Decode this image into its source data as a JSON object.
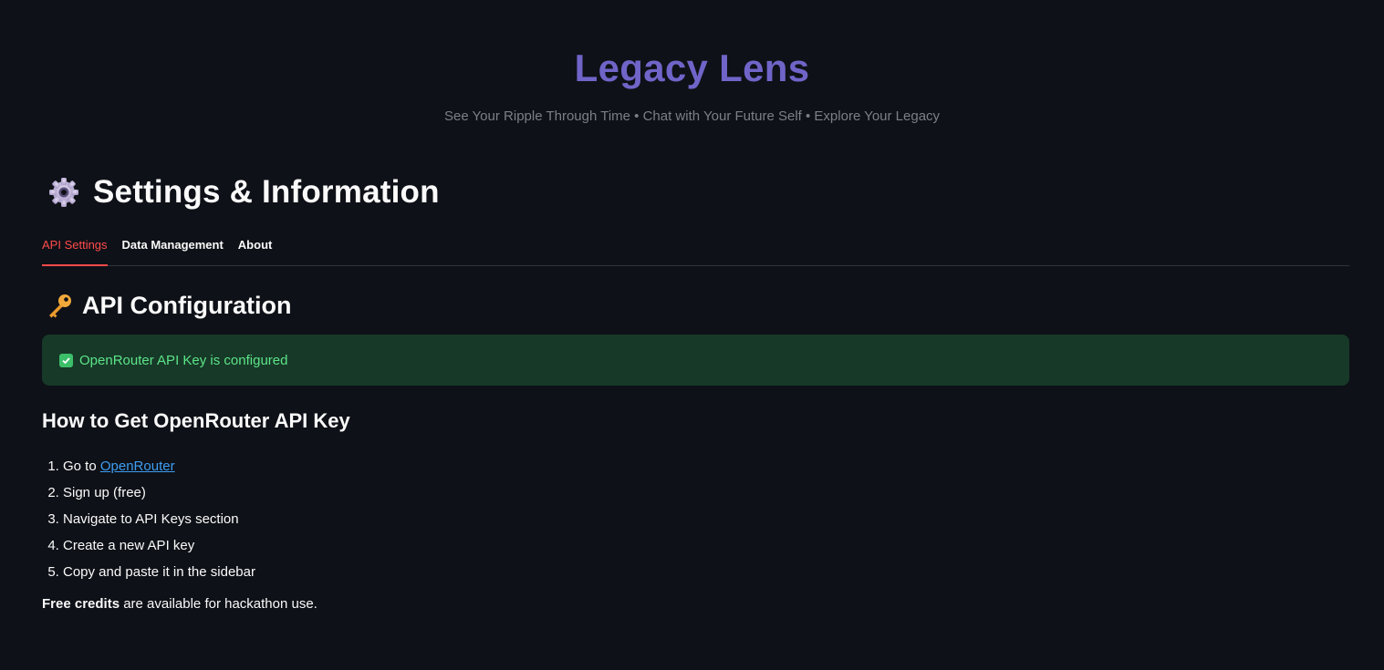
{
  "header": {
    "title": "Legacy Lens",
    "subtitle": "See Your Ripple Through Time • Chat with Your Future Self • Explore Your Legacy"
  },
  "page": {
    "title": "Settings & Information",
    "icon": "gear-icon"
  },
  "tabs": [
    {
      "label": "API Settings",
      "active": true
    },
    {
      "label": "Data Management",
      "active": false
    },
    {
      "label": "About",
      "active": false
    }
  ],
  "api_section": {
    "icon": "key-icon",
    "title": "API Configuration",
    "status_message": "OpenRouter API Key is configured",
    "status_color": "#5ce488"
  },
  "howto": {
    "title": "How to Get OpenRouter API Key",
    "steps": [
      {
        "prefix": "Go to ",
        "link": "OpenRouter"
      },
      {
        "text": "Sign up (free)"
      },
      {
        "text": "Navigate to API Keys section"
      },
      {
        "text": "Create a new API key"
      },
      {
        "text": "Copy and paste it in the sidebar"
      }
    ],
    "note_bold": "Free credits",
    "note_rest": " are available for hackathon use."
  },
  "colors": {
    "background": "#0e1117",
    "accent": "#6f65c8",
    "tab_active": "#ff4b4b",
    "link": "#3d9df3"
  }
}
